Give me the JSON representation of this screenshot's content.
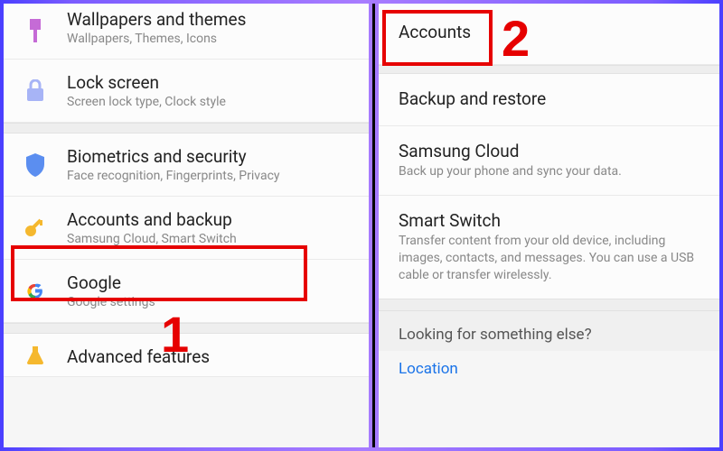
{
  "left": {
    "items": [
      {
        "title": "Wallpapers and themes",
        "sub": "Wallpapers, Themes, Icons",
        "icon": "brush"
      },
      {
        "title": "Lock screen",
        "sub": "Screen lock type, Clock style",
        "icon": "lock"
      },
      {
        "title": "Biometrics and security",
        "sub": "Face recognition, Fingerprints, Privacy",
        "icon": "shield"
      },
      {
        "title": "Accounts and backup",
        "sub": "Samsung Cloud, Smart Switch",
        "icon": "key"
      },
      {
        "title": "Google",
        "sub": "Google settings",
        "icon": "google"
      },
      {
        "title": "Advanced features",
        "sub": "",
        "icon": "flask"
      }
    ]
  },
  "right": {
    "items": [
      {
        "title": "Accounts",
        "sub": ""
      },
      {
        "title": "Backup and restore",
        "sub": ""
      },
      {
        "title": "Samsung Cloud",
        "sub": "Back up your phone and sync your data."
      },
      {
        "title": "Smart Switch",
        "sub": "Transfer content from your old device, including images, contacts, and messages. You can use a USB cable or transfer wirelessly."
      }
    ],
    "footer_label": "Looking for something else?",
    "footer_link": "Location"
  },
  "annotations": {
    "step1": "1",
    "step2": "2"
  }
}
